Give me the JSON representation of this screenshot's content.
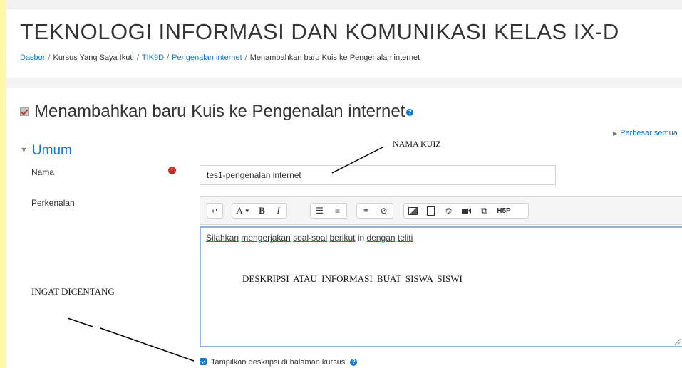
{
  "header": {
    "course_title": "TEKNOLOGI INFORMASI DAN KOMUNIKASI KELAS IX-D",
    "breadcrumb": [
      {
        "label": "Dasbor",
        "link": true
      },
      {
        "label": "Kursus Yang Saya Ikuti",
        "link": false
      },
      {
        "label": "TIK9D",
        "link": true
      },
      {
        "label": "Pengenalan internet",
        "link": true
      },
      {
        "label": "Menambahkan baru Kuis ke Pengenalan internet",
        "link": false
      }
    ]
  },
  "form": {
    "title": "Menambahkan baru Kuis ke Pengenalan internet",
    "expand_all": "Perbesar semua",
    "section": "Umum",
    "name_label": "Nama",
    "name_value": "tes1-pengenalan internet",
    "description_label": "Perkenalan",
    "description_words": [
      "Silahkan",
      "mengerjakan",
      "soal-soal",
      "berikut",
      "in",
      "dengan",
      "teliti"
    ],
    "show_description_label": "Tampilkan deskripsi di halaman kursus",
    "show_description_checked": true
  },
  "toolbar": {
    "groups": [
      [
        "toolbar-collapse"
      ],
      [
        "font-size-dropdown",
        "bold",
        "italic"
      ],
      [
        "unordered-list",
        "ordered-list"
      ],
      [
        "link",
        "unlink"
      ],
      [
        "image",
        "media",
        "record-audio",
        "record-video",
        "manage-files",
        "h5p"
      ]
    ],
    "labels": {
      "font": "A",
      "bold": "B",
      "italic": "I",
      "h5p": "H5P"
    }
  },
  "annotations": {
    "quiz_name": "NAMA KUIZ",
    "description_info": "DESKRIPSI ATAU INFORMASI BUAT SISWA SISWI",
    "remember_check": "INGAT DICENTANG"
  },
  "colors": {
    "link": "#1177d1",
    "required": "#c9302c",
    "editor_focus": "#8ab4e6",
    "left_strip": "#fff7a8"
  }
}
